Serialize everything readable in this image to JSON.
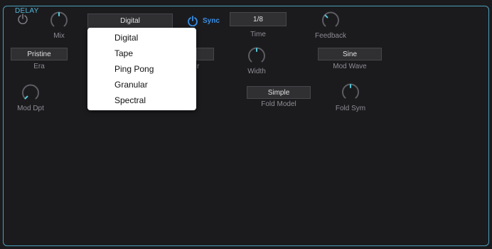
{
  "panel": {
    "title": "DELAY"
  },
  "row1": {
    "mix_label": "Mix",
    "algorithm_value": "Digital",
    "sync_label": "Sync",
    "time_value": "1/8",
    "time_label": "Time",
    "feedback_label": "Feedback"
  },
  "row2": {
    "era_value": "Pristine",
    "era_label": "Era",
    "hidden_label_fragment": "r",
    "width_label": "Width",
    "mod_wave_value": "Sine",
    "mod_wave_label": "Mod Wave"
  },
  "row3": {
    "mod_depth_label": "Mod Dpt",
    "fold_model_value": "Simple",
    "fold_model_label": "Fold Model",
    "fold_sym_label": "Fold Sym"
  },
  "dropdown": {
    "items": [
      "Digital",
      "Tape",
      "Ping Pong",
      "Granular",
      "Spectral"
    ]
  },
  "colors": {
    "accent": "#4a9fb8",
    "sync_on": "#3b8fe6",
    "knob_indicator": "#53c8d8",
    "background": "#1b1b1e"
  },
  "icons": {
    "power": "power-icon",
    "sync": "power-icon"
  }
}
